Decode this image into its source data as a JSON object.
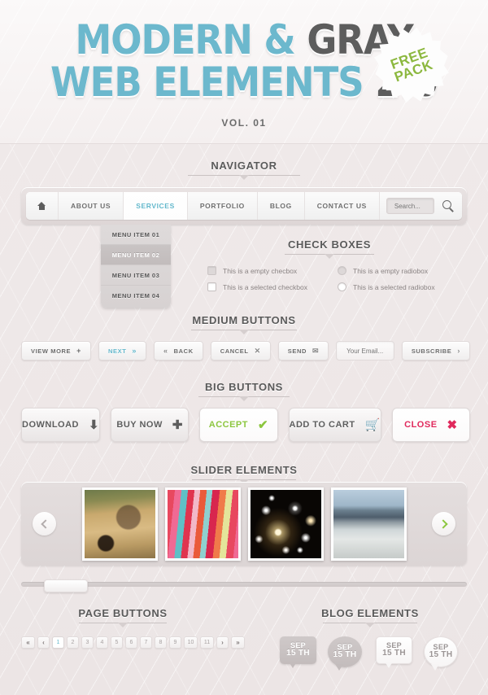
{
  "hero": {
    "title_part1": "MODERN &",
    "title_part2": "GRAY",
    "title_part3": "WEB ELEMENTS",
    "title_part4": "2.0",
    "volume": "VOL. 01",
    "badge_line1": "FREE",
    "badge_line2": "PACK"
  },
  "sections": {
    "navigator": "NAVIGATOR",
    "check_boxes": "CHECK BOXES",
    "medium_buttons": "MEDIUM BUTTONS",
    "big_buttons": "BIG BUTTONS",
    "slider_elements": "SLIDER ELEMENTS",
    "page_buttons": "PAGE BUTTONS",
    "blog_elements": "BLOG ELEMENTS"
  },
  "navigator": {
    "home_icon": "home-icon",
    "items": [
      {
        "label": "ABOUT US",
        "active": false
      },
      {
        "label": "SERVICES",
        "active": true
      },
      {
        "label": "PORTFOLIO",
        "active": false
      },
      {
        "label": "BLOG",
        "active": false
      },
      {
        "label": "CONTACT US",
        "active": false
      }
    ],
    "search": {
      "placeholder": "Search...",
      "value": "",
      "icon": "search-icon"
    }
  },
  "dropdown": {
    "items": [
      {
        "label": "MENU ITEM 01",
        "selected": false
      },
      {
        "label": "MENU ITEM 02",
        "selected": true
      },
      {
        "label": "MENU ITEM 03",
        "selected": false
      },
      {
        "label": "MENU ITEM 04",
        "selected": false
      }
    ]
  },
  "checkboxes": {
    "empty_checkbox": "This is a empty checbox",
    "selected_checkbox": "This is a selected checkbox",
    "empty_radiobox": "This is a empty radiobox",
    "selected_radiobox": "This is a selected radiobox"
  },
  "medium_buttons": [
    {
      "label": "VIEW MORE",
      "icon": "plus-icon",
      "glyph": "+",
      "accent": false,
      "icon_first": false
    },
    {
      "label": "NEXT",
      "icon": "double-chevron-right-icon",
      "glyph": "»",
      "accent": true,
      "icon_first": false
    },
    {
      "label": "BACK",
      "icon": "double-chevron-left-icon",
      "glyph": "«",
      "accent": false,
      "icon_first": true
    },
    {
      "label": "CANCEL",
      "icon": "close-x-icon",
      "glyph": "✕",
      "accent": false,
      "icon_first": false
    },
    {
      "label": "SEND",
      "icon": "envelope-icon",
      "glyph": "✉",
      "accent": false,
      "icon_first": false
    },
    {
      "label": "SUBSCRIBE",
      "icon": "chevron-right-icon",
      "glyph": "›",
      "accent": false,
      "icon_first": false
    }
  ],
  "email_field": {
    "placeholder": "Your Email......",
    "value": ""
  },
  "big_buttons": [
    {
      "label": "DOWNLOAD",
      "icon": "download-arrow-icon",
      "glyph": "⬇",
      "style": "dark"
    },
    {
      "label": "BUY NOW",
      "icon": "plus-icon",
      "glyph": "✚",
      "style": "dark"
    },
    {
      "label": "ACCEPT",
      "icon": "checkmark-icon",
      "glyph": "✔",
      "style": "green"
    },
    {
      "label": "ADD TO CART",
      "icon": "shopping-cart-icon",
      "glyph": "Ὥ2",
      "style": "dark"
    },
    {
      "label": "CLOSE",
      "icon": "close-x-icon",
      "glyph": "✖",
      "style": "pink"
    }
  ],
  "slider": {
    "prev_icon": "chevron-left-icon",
    "next_icon": "chevron-right-icon",
    "thumbnails": [
      {
        "name": "dirt-bike-photo",
        "style": "bike"
      },
      {
        "name": "colorful-fabric-photo",
        "style": "fabric"
      },
      {
        "name": "galaxy-stars-photo",
        "style": "space"
      },
      {
        "name": "snowy-lake-photo",
        "style": "lake"
      }
    ]
  },
  "scrollbar": {
    "handle_position_percent": 5
  },
  "pagination": {
    "first_icon": "«",
    "prev_icon": "‹",
    "next_icon": "›",
    "last_icon": "»",
    "pages": [
      "1",
      "2",
      "3",
      "4",
      "5",
      "6",
      "7",
      "8",
      "9",
      "10",
      "11"
    ],
    "active_page": "1"
  },
  "blog_badges": [
    {
      "month": "SEP",
      "day": "15 TH",
      "shape": "sq",
      "tone": "dark"
    },
    {
      "month": "SEP",
      "day": "15 TH",
      "shape": "ci",
      "tone": "dark"
    },
    {
      "month": "SEP",
      "day": "15 TH",
      "shape": "sq",
      "tone": "lite"
    },
    {
      "month": "SEP",
      "day": "15 TH",
      "shape": "ci",
      "tone": "lite"
    }
  ],
  "colors": {
    "accent_teal": "#63b8cc",
    "accent_green": "#8cc63f",
    "accent_pink": "#e0295c",
    "text_gray": "#5d5d5d",
    "background": "#efe9e9"
  }
}
